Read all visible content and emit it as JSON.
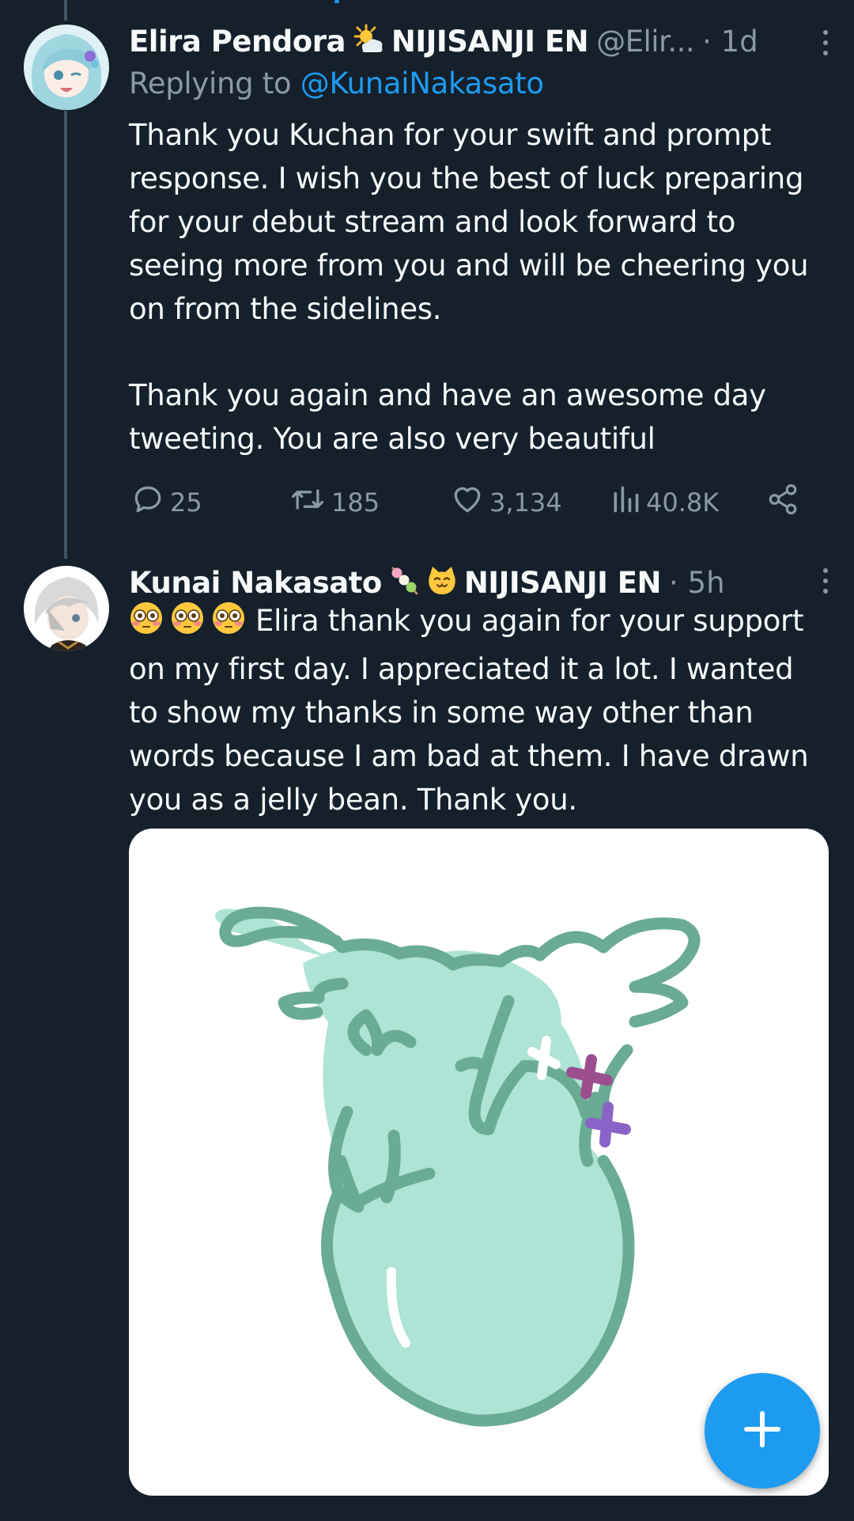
{
  "thread": {
    "tweets": [
      {
        "author": {
          "name": "Elira Pendora",
          "affiliation": "NIJISANJI EN",
          "handle": "@Elir...",
          "time": "· 1d"
        },
        "reply": {
          "prefix": "Replying to",
          "mention": "@KunaiNakasato"
        },
        "text": [
          "Thank you Kuchan for your swift and prompt",
          "response. I wish you the best of luck preparing",
          "for your debut stream and look forward to",
          "seeing more from you and will be cheering you",
          "on from the sidelines.",
          "Thank you again and have an awesome day",
          "tweeting. You are also very beautiful"
        ],
        "stats": {
          "replies": "25",
          "retweets": "185",
          "likes": "3,134",
          "views": "40.8K"
        }
      },
      {
        "author": {
          "name": "Kunai Nakasato",
          "affiliation": "NIJISANJI EN",
          "time": "· 5h"
        },
        "text": [
          "Elira thank you again for your support",
          "on my first day. I appreciated it a lot. I wanted",
          "to show my thanks in some way other than",
          "words because I am bad at them. I have drawn",
          "you as a jelly bean. Thank you."
        ]
      }
    ]
  },
  "icons": {
    "reply": "reply-icon",
    "retweet": "retweet-icon",
    "like": "heart-icon",
    "views": "views-icon",
    "share": "share-icon",
    "more": "more-icon",
    "compose": "plus-icon"
  },
  "colors": {
    "background": "#15202b",
    "accent": "#1d9bf0",
    "muted": "#8b98a5",
    "text": "#f7f9f9",
    "jellybean_fill": "#aee4d5",
    "jellybean_outline": "#6aab93"
  }
}
